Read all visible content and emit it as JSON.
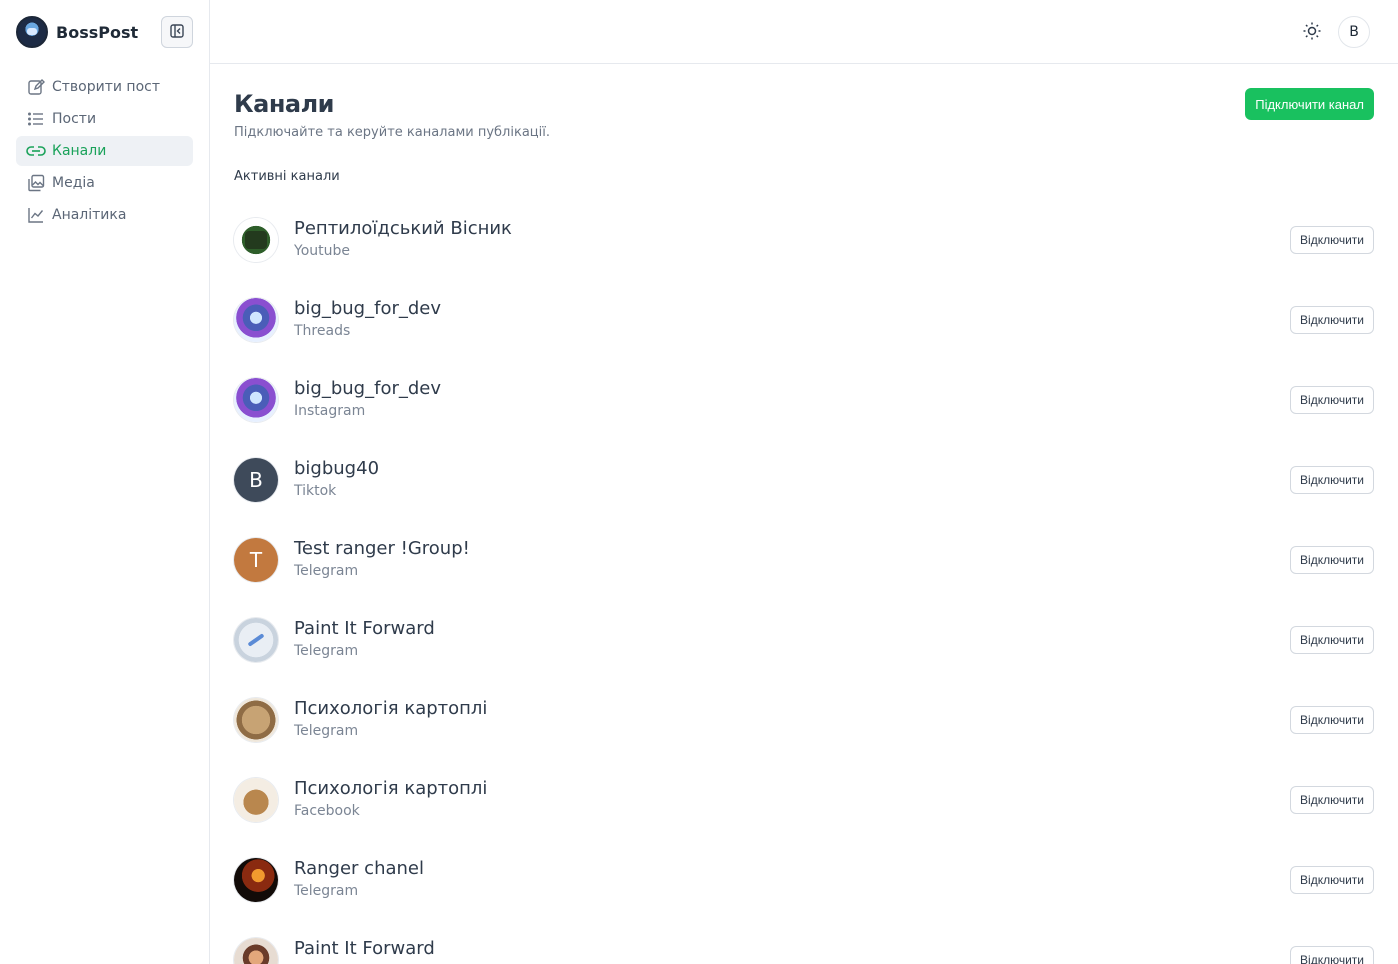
{
  "app": {
    "name": "BossPost"
  },
  "sidebar": {
    "items": [
      {
        "label": "Створити пост",
        "icon": "edit-icon",
        "active": false
      },
      {
        "label": "Пости",
        "icon": "list-icon",
        "active": false
      },
      {
        "label": "Канали",
        "icon": "link-icon",
        "active": true
      },
      {
        "label": "Медіа",
        "icon": "images-icon",
        "active": false
      },
      {
        "label": "Аналітика",
        "icon": "chart-icon",
        "active": false
      }
    ]
  },
  "topbar": {
    "theme_icon": "sun-icon",
    "user_initial": "B"
  },
  "page": {
    "title": "Канали",
    "subtitle": "Підключайте та керуйте каналами публікації.",
    "connect_button": "Підключити канал",
    "section_label": "Активні канали"
  },
  "channels": [
    {
      "name": "Рептилоїдський Вісник",
      "platform": "Youtube",
      "avatar": "image",
      "disconnect": "Відключити"
    },
    {
      "name": "big_bug_for_dev",
      "platform": "Threads",
      "avatar": "image",
      "disconnect": "Відключити"
    },
    {
      "name": "big_bug_for_dev",
      "platform": "Instagram",
      "avatar": "image",
      "disconnect": "Відключити"
    },
    {
      "name": "bigbug40",
      "platform": "Tiktok",
      "avatar_letter": "B",
      "disconnect": "Відключити"
    },
    {
      "name": "Test ranger !Group!",
      "platform": "Telegram",
      "avatar_letter": "T",
      "disconnect": "Відключити"
    },
    {
      "name": "Paint It Forward",
      "platform": "Telegram",
      "avatar": "image",
      "disconnect": "Відключити"
    },
    {
      "name": "Психологія картоплі",
      "platform": "Telegram",
      "avatar": "image",
      "disconnect": "Відключити"
    },
    {
      "name": "Психологія картоплі",
      "platform": "Facebook",
      "avatar": "image",
      "disconnect": "Відключити"
    },
    {
      "name": "Ranger chanel",
      "platform": "Telegram",
      "avatar": "image",
      "disconnect": "Відключити"
    },
    {
      "name": "Paint It Forward",
      "platform": "",
      "avatar": "image",
      "disconnect": "Відключити"
    }
  ],
  "colors": {
    "accent": "#19c15f",
    "active_nav_text": "#1aa25a",
    "text": "#2f3b4b",
    "muted": "#7b8594"
  }
}
